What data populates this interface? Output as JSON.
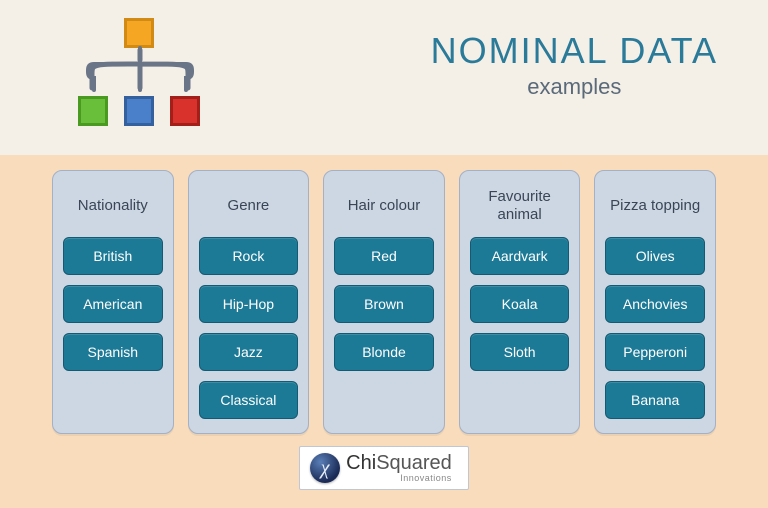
{
  "title": "NOMINAL DATA",
  "subtitle": "examples",
  "categories": [
    {
      "name": "Nationality",
      "items": [
        "British",
        "American",
        "Spanish"
      ]
    },
    {
      "name": "Genre",
      "items": [
        "Rock",
        "Hip-Hop",
        "Jazz",
        "Classical"
      ]
    },
    {
      "name": "Hair colour",
      "items": [
        "Red",
        "Brown",
        "Blonde"
      ]
    },
    {
      "name": "Favourite animal",
      "items": [
        "Aardvark",
        "Koala",
        "Sloth"
      ]
    },
    {
      "name": "Pizza topping",
      "items": [
        "Olives",
        "Anchovies",
        "Pepperoni",
        "Banana"
      ]
    }
  ],
  "logo": {
    "mark": "χ",
    "name_a": "Chi",
    "name_b": "Squared",
    "sub": "Innovations"
  }
}
